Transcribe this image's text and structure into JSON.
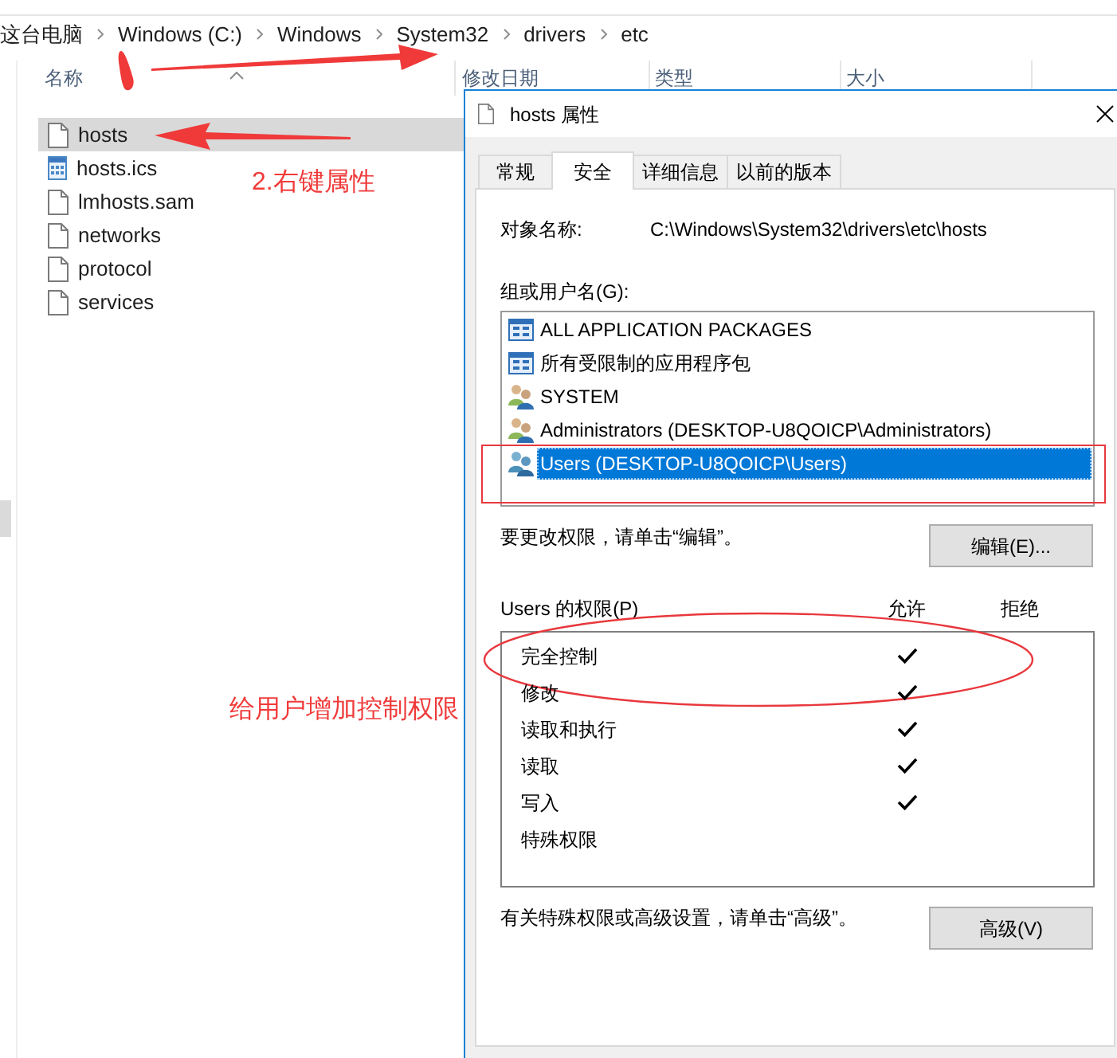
{
  "address_bar": {
    "path": [
      "这台电脑",
      "Windows (C:)",
      "Windows",
      "System32",
      "drivers",
      "etc"
    ]
  },
  "file_list": {
    "columns": [
      "名称",
      "修改日期",
      "类型",
      "大小"
    ],
    "files": [
      {
        "name": "hosts",
        "kind": "document",
        "selected": true
      },
      {
        "name": "hosts.ics",
        "kind": "calendar",
        "selected": false
      },
      {
        "name": "lmhosts.sam",
        "kind": "document",
        "selected": false
      },
      {
        "name": "networks",
        "kind": "document",
        "selected": false
      },
      {
        "name": "protocol",
        "kind": "document",
        "selected": false
      },
      {
        "name": "services",
        "kind": "document",
        "selected": false
      }
    ]
  },
  "annotations": {
    "step_label": "2.右键属性",
    "note": "给用户增加控制权限"
  },
  "dialog": {
    "title": "hosts 属性",
    "tabs": [
      {
        "label": "常规",
        "selected": false
      },
      {
        "label": "安全",
        "selected": true
      },
      {
        "label": "详细信息",
        "selected": false
      },
      {
        "label": "以前的版本",
        "selected": false
      }
    ],
    "object_name_label": "对象名称:",
    "object_name": "C:\\Windows\\System32\\drivers\\etc\\hosts",
    "groups_label": "组或用户名(G):",
    "groups": [
      {
        "name": "ALL APPLICATION PACKAGES",
        "kind": "app-package",
        "selected": false,
        "highlighted": false
      },
      {
        "name": "所有受限制的应用程序包",
        "kind": "app-package",
        "selected": false,
        "highlighted": false
      },
      {
        "name": "SYSTEM",
        "kind": "admin-group",
        "selected": false,
        "highlighted": false
      },
      {
        "name": "Administrators (DESKTOP-U8QOICP\\Administrators)",
        "kind": "admin-group",
        "selected": false,
        "highlighted": false
      },
      {
        "name": "Users (DESKTOP-U8QOICP\\Users)",
        "kind": "user-group",
        "selected": true,
        "highlighted": true
      }
    ],
    "edit_hint": "要更改权限，请单击“编辑”。",
    "edit_button": "编辑(E)...",
    "permissions_label": "Users 的权限(P)",
    "permission_columns": [
      "允许",
      "拒绝"
    ],
    "permissions": [
      {
        "name": "完全控制",
        "allow": true,
        "deny": false,
        "highlighted": true
      },
      {
        "name": "修改",
        "allow": true,
        "deny": false,
        "highlighted": false
      },
      {
        "name": "读取和执行",
        "allow": true,
        "deny": false,
        "highlighted": false
      },
      {
        "name": "读取",
        "allow": true,
        "deny": false,
        "highlighted": false
      },
      {
        "name": "写入",
        "allow": true,
        "deny": false,
        "highlighted": false
      },
      {
        "name": "特殊权限",
        "allow": false,
        "deny": false,
        "highlighted": false
      }
    ],
    "advanced_hint": "有关特殊权限或高级设置，请单击“高级”。",
    "advanced_button": "高级(V)"
  }
}
